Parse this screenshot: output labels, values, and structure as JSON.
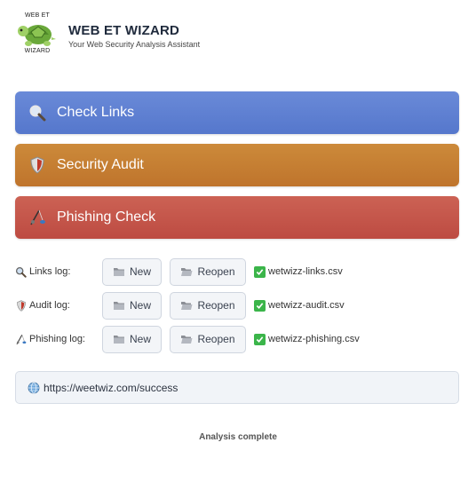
{
  "header": {
    "logo_top_text": "WEB ET",
    "logo_bottom_text": "WIZARD",
    "title": "WEB ET WIZARD",
    "subtitle": "Your Web Security Analysis Assistant"
  },
  "actions": [
    {
      "label": "Check Links",
      "icon": "magnifier-icon",
      "color": "#5b7fd0"
    },
    {
      "label": "Security Audit",
      "icon": "shield-icon",
      "color": "#c47e32"
    },
    {
      "label": "Phishing Check",
      "icon": "fishing-pole-icon",
      "color": "#c2554a"
    }
  ],
  "logs": [
    {
      "label": "Links log:",
      "icon": "magnifier-icon",
      "new_label": "New",
      "reopen_label": "Reopen",
      "file": "wetwizz-links.csv"
    },
    {
      "label": "Audit log:",
      "icon": "shield-icon",
      "new_label": "New",
      "reopen_label": "Reopen",
      "file": "wetwizz-audit.csv"
    },
    {
      "label": "Phishing log:",
      "icon": "fishing-pole-icon",
      "new_label": "New",
      "reopen_label": "Reopen",
      "file": "wetwizz-phishing.csv"
    }
  ],
  "url_bar": {
    "icon": "globe-icon",
    "value": "https://weetwiz.com/success"
  },
  "status": "Analysis complete"
}
